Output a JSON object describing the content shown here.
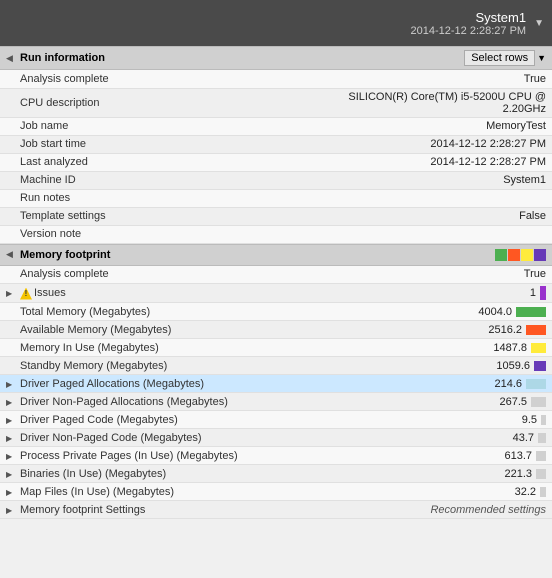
{
  "topBar": {
    "systemName": "System1",
    "systemDate": "2014-12-12 2:28:27 PM",
    "dropdownLabel": "System1 ▼"
  },
  "runInfo": {
    "sectionTitle": "Run information",
    "selectRowsLabel": "Select rows",
    "rows": [
      {
        "label": "Analysis complete",
        "value": "True"
      },
      {
        "label": "CPU description",
        "value": "SILICON(R) Core(TM) i5-5200U CPU @ 2.20GHz"
      },
      {
        "label": "Job name",
        "value": "MemoryTest"
      },
      {
        "label": "Job start time",
        "value": "2014-12-12 2:28:27 PM"
      },
      {
        "label": "Last analyzed",
        "value": "2014-12-12 2:28:27 PM"
      },
      {
        "label": "Machine ID",
        "value": "System1"
      },
      {
        "label": "Run notes",
        "value": ""
      },
      {
        "label": "Template settings",
        "value": "False"
      },
      {
        "label": "Version note",
        "value": ""
      }
    ]
  },
  "memoryFootprint": {
    "sectionTitle": "Memory footprint",
    "colorBoxes": [
      "#4caf50",
      "#ff5722",
      "#ffeb3b",
      "#673ab7"
    ],
    "rows": [
      {
        "label": "Analysis complete",
        "value": "True",
        "indent": 1,
        "expandable": false,
        "selected": false,
        "barColor": null,
        "barWidth": 0
      },
      {
        "label": "Issues",
        "value": "1",
        "indent": 1,
        "expandable": true,
        "selected": false,
        "isIssue": true,
        "barColor": "#9932CC",
        "barWidth": 6
      },
      {
        "label": "Total Memory (Megabytes)",
        "value": "4004.0",
        "indent": 1,
        "expandable": false,
        "selected": false,
        "barColor": "#4caf50",
        "barWidth": 30
      },
      {
        "label": "Available Memory (Megabytes)",
        "value": "2516.2",
        "indent": 1,
        "expandable": false,
        "selected": false,
        "barColor": "#ff5722",
        "barWidth": 20
      },
      {
        "label": "Memory In Use (Megabytes)",
        "value": "1487.8",
        "indent": 1,
        "expandable": false,
        "selected": false,
        "barColor": "#ffeb3b",
        "barWidth": 15
      },
      {
        "label": "Standby Memory (Megabytes)",
        "value": "1059.6",
        "indent": 1,
        "expandable": false,
        "selected": false,
        "barColor": "#673ab7",
        "barWidth": 12
      },
      {
        "label": "Driver Paged Allocations (Megabytes)",
        "value": "214.6",
        "indent": 1,
        "expandable": true,
        "selected": true,
        "barColor": "#add8e6",
        "barWidth": 20
      },
      {
        "label": "Driver Non-Paged Allocations (Megabytes)",
        "value": "267.5",
        "indent": 1,
        "expandable": true,
        "selected": false,
        "barColor": "#d0d0d0",
        "barWidth": 15
      },
      {
        "label": "Driver Paged Code (Megabytes)",
        "value": "9.5",
        "indent": 1,
        "expandable": true,
        "selected": false,
        "barColor": "#d0d0d0",
        "barWidth": 5
      },
      {
        "label": "Driver Non-Paged Code (Megabytes)",
        "value": "43.7",
        "indent": 1,
        "expandable": true,
        "selected": false,
        "barColor": "#d0d0d0",
        "barWidth": 8
      },
      {
        "label": "Process Private Pages (In Use) (Megabytes)",
        "value": "613.7",
        "indent": 1,
        "expandable": true,
        "selected": false,
        "barColor": "#d0d0d0",
        "barWidth": 10
      },
      {
        "label": "Binaries (In Use) (Megabytes)",
        "value": "221.3",
        "indent": 1,
        "expandable": true,
        "selected": false,
        "barColor": "#d0d0d0",
        "barWidth": 10
      },
      {
        "label": "Map Files (In Use) (Megabytes)",
        "value": "32.2",
        "indent": 1,
        "expandable": true,
        "selected": false,
        "barColor": "#d0d0d0",
        "barWidth": 6
      },
      {
        "label": "Memory footprint Settings",
        "value": "Recommended settings",
        "indent": 1,
        "expandable": true,
        "selected": false,
        "barColor": null,
        "barWidth": 0,
        "isSettings": true
      }
    ]
  }
}
